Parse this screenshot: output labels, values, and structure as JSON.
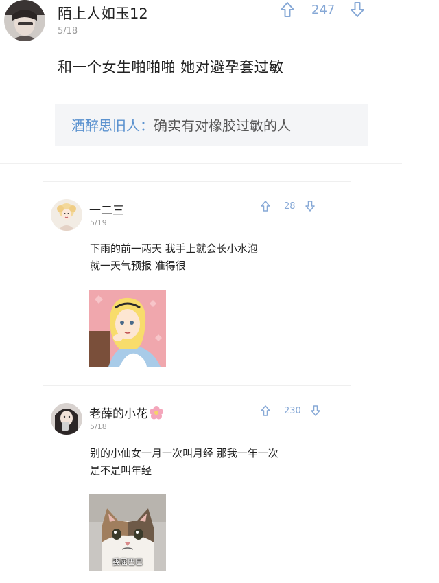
{
  "top_comment": {
    "username": "陌上人如玉12",
    "date": "5/18",
    "upvotes": "247",
    "text": "和一个女生啪啪啪  她对避孕套过敏",
    "reply": {
      "author": "酒醉思旧人",
      "separator": "：",
      "text": "确实有对橡胶过敏的人"
    }
  },
  "sub_comments": [
    {
      "username": "一二三",
      "date": "5/19",
      "upvotes": "28",
      "lines": [
        "下雨的前一两天   我手上就会长小水泡",
        "就一天气预报  准得很"
      ],
      "image_icon": "alice-cartoon-image"
    },
    {
      "username": "老薛的小花",
      "date": "5/18",
      "upvotes": "230",
      "lines": [
        "别的小仙女一月一次叫月经  那我一年一次",
        "是不是叫年经"
      ],
      "image_icon": "sad-cat-image",
      "image_caption": "委屈巴巴"
    }
  ],
  "colors": {
    "vote_blue": "#86a8d6",
    "reply_author_blue": "#5b92cf",
    "reply_bg": "#f4f5f7"
  }
}
